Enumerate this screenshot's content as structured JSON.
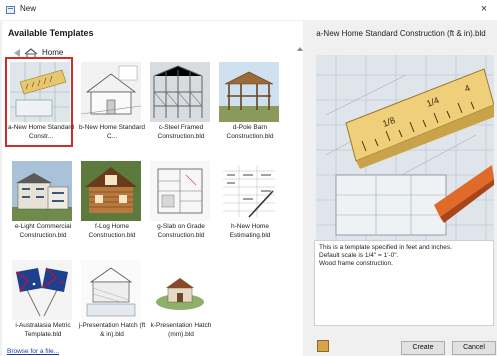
{
  "window": {
    "title": "New",
    "close_glyph": "×"
  },
  "left": {
    "heading": "Available Templates",
    "nav": {
      "home_label": "Home"
    },
    "templates": [
      {
        "caption": "a-New Home Standard Constr...",
        "selected": true,
        "icon": "ruler-blueprint-thumbnail"
      },
      {
        "caption": "b-New Home Standard C...",
        "selected": false,
        "icon": "house-drawing-thumbnail"
      },
      {
        "caption": "c-Steel Framed Construction.bld",
        "selected": false,
        "icon": "steel-frame-thumbnail"
      },
      {
        "caption": "d-Pole Barn Construction.bld",
        "selected": false,
        "icon": "pole-barn-thumbnail"
      },
      {
        "caption": "e-Light Commercial Construction.bld",
        "selected": false,
        "icon": "commercial-building-thumbnail"
      },
      {
        "caption": "f-Log Home Construction.bld",
        "selected": false,
        "icon": "log-home-thumbnail"
      },
      {
        "caption": "g-Slab on Grade Construction.bld",
        "selected": false,
        "icon": "slab-plan-thumbnail"
      },
      {
        "caption": "h-New Home Estimating.bld",
        "selected": false,
        "icon": "estimate-sheet-thumbnail"
      },
      {
        "caption": "i-Australasia Metric Template.bld",
        "selected": false,
        "icon": "australia-nz-flags-thumbnail"
      },
      {
        "caption": "j-Presentation Hatch (ft & in).bld",
        "selected": false,
        "icon": "presentation-plan-thumbnail"
      },
      {
        "caption": "k-Presentation Hatch (mm).bld",
        "selected": false,
        "icon": "presentation-house-thumbnail"
      }
    ],
    "browse_link": "Browse for a file..."
  },
  "right": {
    "title": "a-New Home Standard Construction (ft & in).bld",
    "description": [
      "This is a template specified in feet and inches.",
      "Default scale is 1/4\" = 1'-0\".",
      "Wood frame construction."
    ],
    "buttons": {
      "create": "Create",
      "cancel": "Cancel"
    }
  },
  "colors": {
    "selection_border": "#d32b2b",
    "link": "#1a3e9e",
    "window_bg": "#f0f0f0"
  }
}
